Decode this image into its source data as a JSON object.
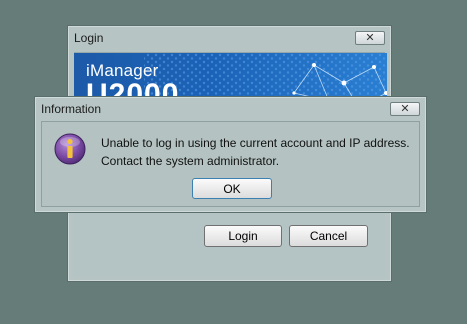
{
  "login_window": {
    "title": "Login",
    "close_glyph": "✕",
    "banner": {
      "brand_line1": "iManager",
      "brand_line2": "U2000"
    },
    "login_label": "Login",
    "cancel_label": "Cancel"
  },
  "info_dialog": {
    "title": "Information",
    "close_glyph": "✕",
    "icon": "info-icon",
    "message_line1": "Unable to log in using the current account and IP address.",
    "message_line2": "Contact the system administrator.",
    "ok_label": "OK"
  },
  "colors": {
    "desktop": "#657c78",
    "window_bg": "#b6c5c4",
    "banner_blue": "#1b63b8",
    "info_icon": "#6a3f8f"
  }
}
